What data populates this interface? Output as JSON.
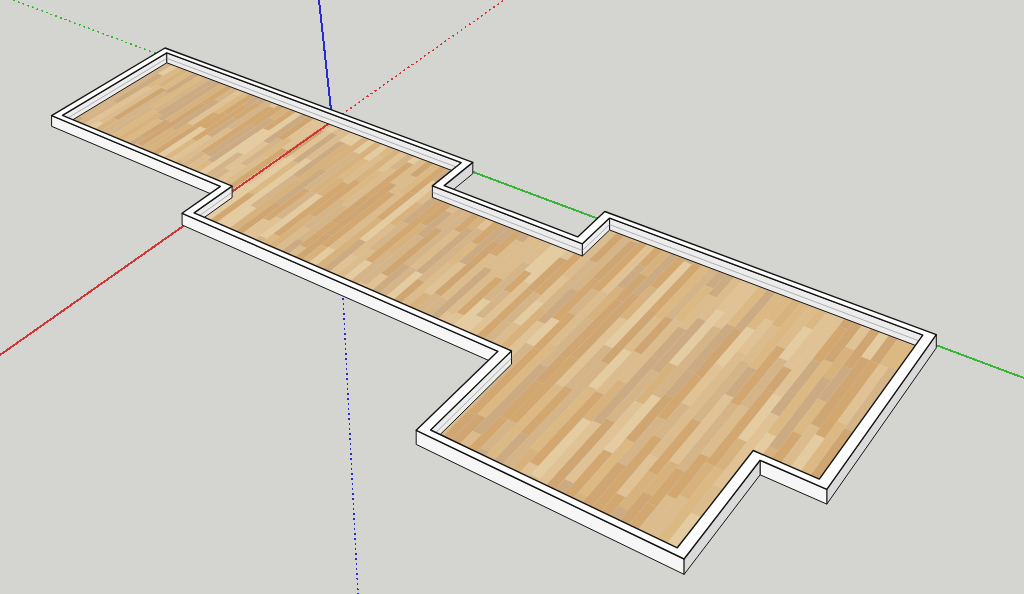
{
  "viewport": {
    "axes": [
      {
        "color": "#d03838"
      },
      {
        "color": "#3cb43c"
      },
      {
        "color": "#2a2ad0"
      }
    ]
  }
}
